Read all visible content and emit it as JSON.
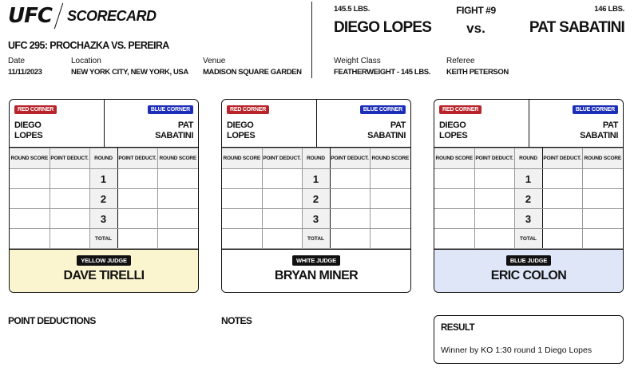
{
  "header": {
    "logo": "UFC",
    "scorecard_label": "SCORECARD",
    "event_title": "UFC 295: PROCHAZKA VS. PEREIRA",
    "date_label": "Date",
    "date": "11/11/2023",
    "location_label": "Location",
    "location": "NEW YORK CITY, NEW YORK, USA",
    "venue_label": "Venue",
    "venue": "MADISON SQUARE GARDEN",
    "weight_class_label": "Weight Class",
    "weight_class": "FEATHERWEIGHT - 145 LBS.",
    "referee_label": "Referee",
    "referee": "KEITH PETERSON"
  },
  "fight": {
    "number": "FIGHT #9",
    "vs": "vs.",
    "red_weight": "145.5 LBS.",
    "blue_weight": "146 LBS.",
    "red_name": "DIEGO LOPES",
    "blue_name": "PAT SABATINI"
  },
  "card_labels": {
    "red_corner": "RED CORNER",
    "blue_corner": "BLUE CORNER",
    "red_first": "DIEGO",
    "red_last": "LOPES",
    "blue_first": "PAT",
    "blue_last": "SABATINI",
    "col_round_score": "ROUND SCORE",
    "col_point_deduct": "POINT DEDUCT.",
    "col_round": "ROUND",
    "rounds": [
      "1",
      "2",
      "3"
    ],
    "total": "TOTAL"
  },
  "judges": [
    {
      "badge": "YELLOW JUDGE",
      "name": "DAVE TIRELLI",
      "color": "#faf5cf"
    },
    {
      "badge": "WHITE JUDGE",
      "name": "BRYAN MINER",
      "color": "#ffffff"
    },
    {
      "badge": "BLUE JUDGE",
      "name": "ERIC COLON",
      "color": "#dfe6f8"
    }
  ],
  "sections": {
    "point_deductions": "POINT DEDUCTIONS",
    "notes": "NOTES",
    "result_title": "RESULT",
    "result_text": "Winner by KO 1:30 round 1 Diego Lopes"
  }
}
